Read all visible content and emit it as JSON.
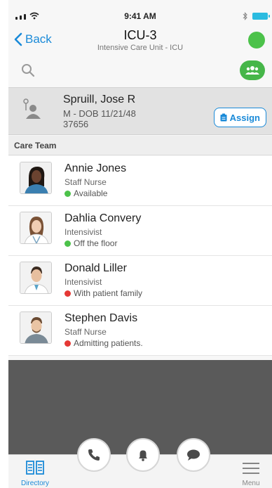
{
  "status_bar": {
    "time": "9:41 AM",
    "signal_icon": "cellular-signal-icon",
    "wifi_icon": "wifi-icon",
    "bluetooth_icon": "bluetooth-icon",
    "battery_icon": "battery-icon",
    "battery_color": "#2bbbe0"
  },
  "nav": {
    "back_label": "Back",
    "title": "ICU-3",
    "subtitle": "Intensive Care Unit - ICU",
    "status_color": "#4cc24a"
  },
  "toolbar": {
    "search_icon": "search-icon",
    "team_icon": "group-chat-icon",
    "team_color": "#46b649"
  },
  "patient": {
    "name": "Spruill, Jose R",
    "dob": "M - DOB 11/21/48",
    "id": "37656",
    "assign_label": "Assign"
  },
  "care_team": {
    "header": "Care Team",
    "members": [
      {
        "name": "Annie Jones",
        "role": "Staff Nurse",
        "status": "Available",
        "status_color": "#4cc24a"
      },
      {
        "name": "Dahlia Convery",
        "role": "Intensivist",
        "status": "Off the floor",
        "status_color": "#4cc24a"
      },
      {
        "name": "Donald Liller",
        "role": "Intensivist",
        "status": "With patient family",
        "status_color": "#e53935"
      },
      {
        "name": "Stephen Davis",
        "role": "Staff Nurse",
        "status": "Admitting patients.",
        "status_color": "#e53935"
      }
    ]
  },
  "tab_bar": {
    "directory_label": "Directory",
    "menu_label": "Menu",
    "accent_color": "#1a8ad8"
  }
}
